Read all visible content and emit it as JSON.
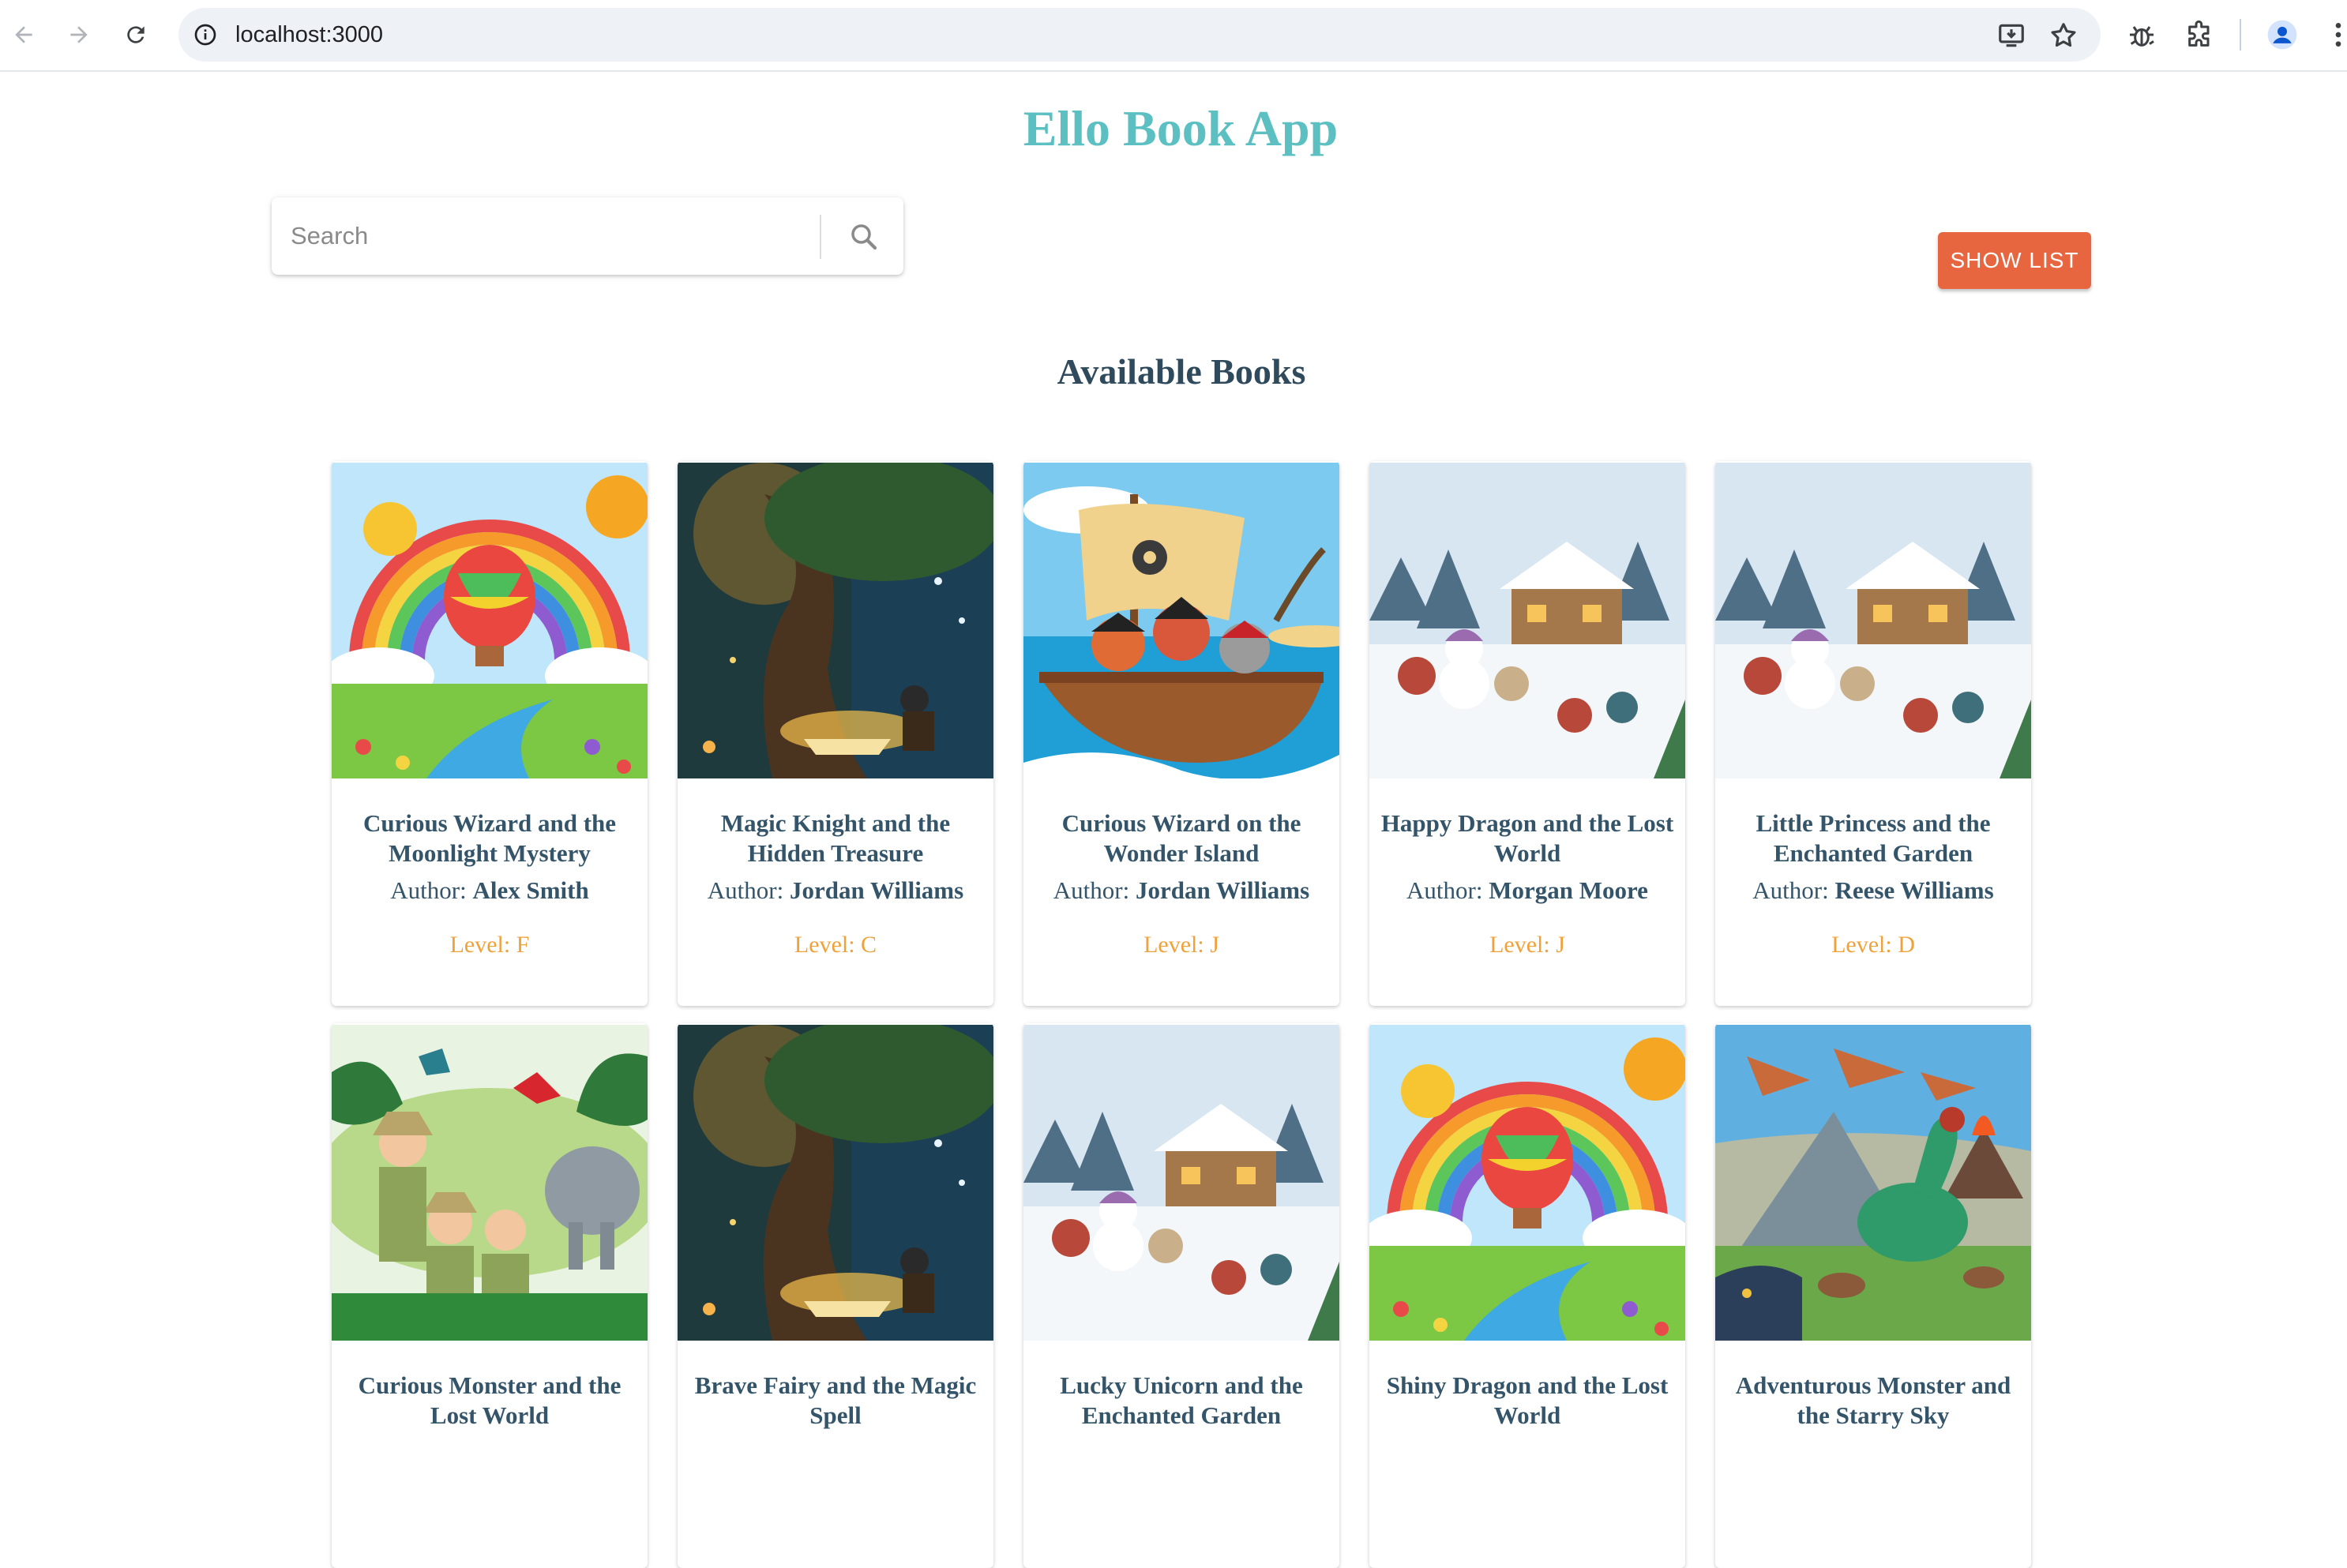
{
  "browser": {
    "url": "localhost:3000",
    "icons": {
      "back": "back-arrow-icon",
      "forward": "forward-arrow-icon",
      "reload": "reload-icon",
      "site_info": "info-icon",
      "install": "install-app-icon",
      "bookmark": "star-icon",
      "extension1": "bug-icon",
      "extensions": "puzzle-icon",
      "profile": "profile-icon",
      "menu": "more-vert-icon"
    }
  },
  "app": {
    "title": "Ello Book App",
    "search_placeholder": "Search",
    "show_list_label": "SHOW LIST",
    "section_title": "Available Books",
    "colors": {
      "title": "#5cc0c2",
      "button": "#e8663f",
      "text": "#34546a",
      "level": "#f0a23a"
    }
  },
  "books": [
    {
      "title": "Curious Wizard and the Moonlight Mystery",
      "author_label": "Author: ",
      "author": "Alex Smith",
      "level": "Level: F",
      "cover": "rainbow-balloon"
    },
    {
      "title": "Magic Knight and the Hidden Treasure",
      "author_label": "Author: ",
      "author": "Jordan Williams",
      "level": "Level: C",
      "cover": "enchanted-tree"
    },
    {
      "title": "Curious Wizard on the Wonder Island",
      "author_label": "Author: ",
      "author": "Jordan Williams",
      "level": "Level: J",
      "cover": "pirate-ship"
    },
    {
      "title": "Happy Dragon and the Lost World",
      "author_label": "Author: ",
      "author": "Morgan Moore",
      "level": "Level: J",
      "cover": "snowy-village"
    },
    {
      "title": "Little Princess and the Enchanted Garden",
      "author_label": "Author: ",
      "author": "Reese Williams",
      "level": "Level: D",
      "cover": "snowy-village"
    },
    {
      "title": "Curious Monster and the Lost World",
      "cover": "jungle-explorers"
    },
    {
      "title": "Brave Fairy and the Magic Spell",
      "cover": "enchanted-tree"
    },
    {
      "title": "Lucky Unicorn and the Enchanted Garden",
      "cover": "snowy-village"
    },
    {
      "title": "Shiny Dragon and the Lost World",
      "cover": "rainbow-balloon"
    },
    {
      "title": "Adventurous Monster and the Starry Sky",
      "cover": "dinosaur-volcano"
    }
  ]
}
